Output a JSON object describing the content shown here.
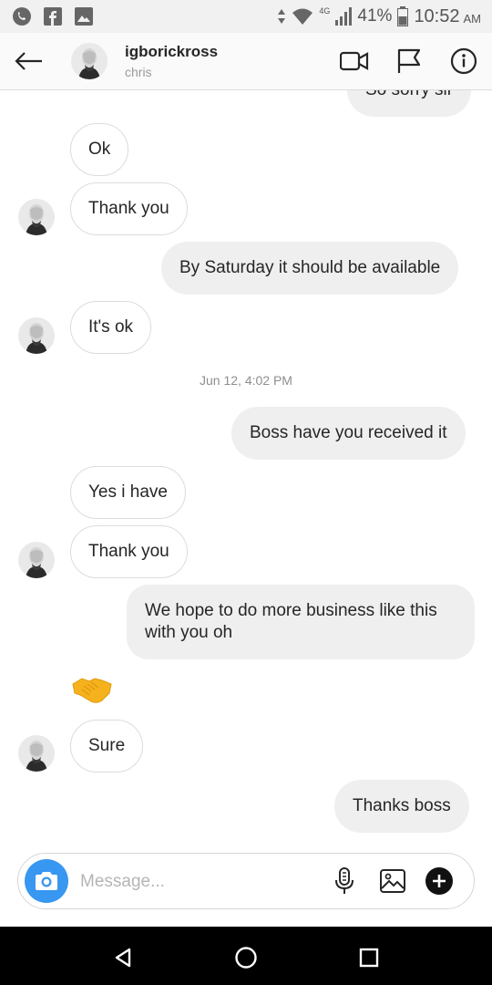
{
  "status_bar": {
    "network": "4G",
    "battery": "41%",
    "time": "10:52",
    "ampm": "AM",
    "left_icons": [
      "whatsapp-icon",
      "facebook-icon",
      "gallery-icon"
    ]
  },
  "header": {
    "username": "igborickross",
    "subtitle": "chris",
    "icons": [
      "back-arrow-icon",
      "video-call-icon",
      "flag-icon",
      "info-icon"
    ]
  },
  "messages": [
    {
      "side": "out",
      "text": "So sorry sir"
    },
    {
      "side": "in",
      "text": "Ok"
    },
    {
      "side": "in",
      "text": "Thank you",
      "avatar": true
    },
    {
      "side": "out",
      "text": "By Saturday it should be available"
    },
    {
      "side": "in",
      "text": "It's ok",
      "avatar": true
    },
    {
      "type": "timestamp",
      "text": "Jun 12, 4:02 PM"
    },
    {
      "side": "out",
      "text": "Boss have you received it"
    },
    {
      "side": "in",
      "text": "Yes i have"
    },
    {
      "side": "in",
      "text": "Thank you",
      "avatar": true
    },
    {
      "side": "out",
      "text": "We hope to do more business like this with you oh"
    },
    {
      "side": "in",
      "type": "emoji",
      "icon": "handshake-emoji"
    },
    {
      "side": "in",
      "text": "Sure",
      "avatar": true
    },
    {
      "side": "out",
      "text": "Thanks boss"
    }
  ],
  "composer": {
    "placeholder": "Message...",
    "icons": [
      "camera-icon",
      "microphone-icon",
      "image-icon",
      "add-icon"
    ]
  },
  "nav_bar": {
    "icons": [
      "nav-back-icon",
      "nav-home-icon",
      "nav-recents-icon"
    ]
  },
  "colors": {
    "camera_button": "#3897f0",
    "outgoing_bubble": "#efefef",
    "incoming_border": "#dcdcdc",
    "emoji": "#f5b21d"
  }
}
